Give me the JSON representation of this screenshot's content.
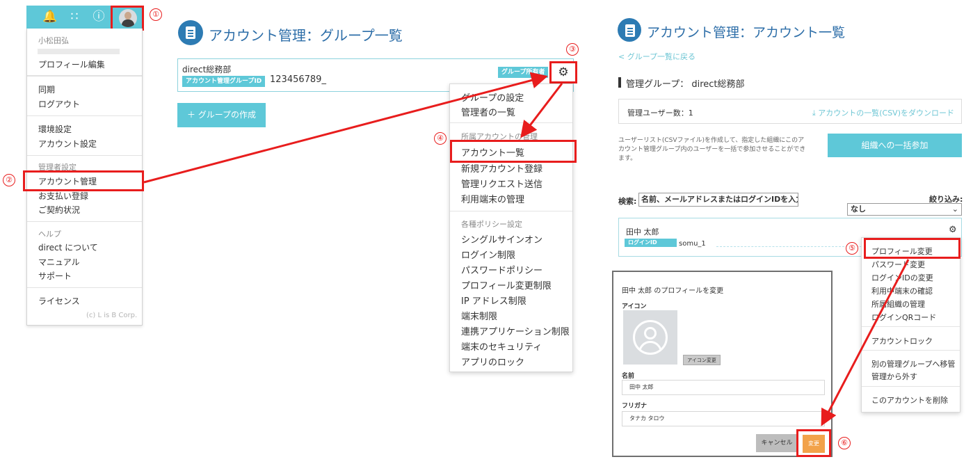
{
  "user_menu": {
    "header_icons": [
      "bell-icon",
      "apps-grid-icon",
      "info-icon"
    ],
    "user_name": "小松田弘",
    "items": [
      {
        "label": "プロフィール編集"
      },
      {
        "label": "同期"
      },
      {
        "label": "ログアウト"
      },
      {
        "label": "環境設定"
      },
      {
        "label": "アカウント設定"
      },
      {
        "label": "管理者設定",
        "type": "section"
      },
      {
        "label": "アカウント管理"
      },
      {
        "label": "お支払い登録"
      },
      {
        "label": "ご契約状況"
      },
      {
        "label": "ヘルプ",
        "type": "section"
      },
      {
        "label": "direct について"
      },
      {
        "label": "マニュアル"
      },
      {
        "label": "サポート"
      },
      {
        "label": "ライセンス"
      }
    ],
    "copyright": "(c) L is B Corp."
  },
  "steps": [
    "①",
    "②",
    "③",
    "④",
    "⑤",
    "⑥"
  ],
  "group_page": {
    "title": "アカウント管理：グループ一覧",
    "group_name": "direct総務部",
    "group_id_tag": "アカウント管理グループID",
    "group_id": "123456789_",
    "owner_tag": "グループ所有者",
    "create_button": "＋ グループの作成"
  },
  "settings_menu": {
    "items": [
      {
        "label": "グループの設定"
      },
      {
        "label": "管理者の一覧"
      },
      {
        "label": "所属アカウントの管理",
        "type": "section"
      },
      {
        "label": "アカウント一覧"
      },
      {
        "label": "新規アカウント登録"
      },
      {
        "label": "管理リクエスト送信"
      },
      {
        "label": "利用端末の管理"
      },
      {
        "label": "各種ポリシー設定",
        "type": "section"
      },
      {
        "label": "シングルサインオン"
      },
      {
        "label": "ログイン制限"
      },
      {
        "label": "パスワードポリシー"
      },
      {
        "label": "プロフィール変更制限"
      },
      {
        "label": "IP アドレス制限"
      },
      {
        "label": "端末制限"
      },
      {
        "label": "連携アプリケーション制限"
      },
      {
        "label": "端末のセキュリティ"
      },
      {
        "label": "アプリのロック"
      }
    ]
  },
  "account_page": {
    "title": "アカウント管理：アカウント一覧",
    "back_link": "< グループ一覧に戻る",
    "managed_group": "管理グループ： direct総務部",
    "admin_count": "管理ユーザー数：1",
    "csv_link": "アカウントの一覧(CSV)をダウンロード",
    "csv_description": "ユーザーリスト(CSVファイル)を作成して、指定した組織にこのアカウント管理グループ内のユーザーを一括で参加させることができます。",
    "bulk_join_button": "組織への一括参加",
    "search_label": "検索:",
    "search_placeholder": "名前、メールアドレスまたはログインIDを入力",
    "filter_label": "絞り込み:",
    "filter_value": "なし",
    "user": {
      "name": "田中 太郎",
      "login_tag": "ログインID",
      "login_id": "somu_1"
    }
  },
  "user_action_menu": {
    "items": [
      {
        "label": "プロフィール変更"
      },
      {
        "label": "パスワード変更"
      },
      {
        "label": "ログインIDの変更"
      },
      {
        "label": "利用中端末の確認"
      },
      {
        "label": "所属組織の管理"
      },
      {
        "label": "ログインQRコード"
      },
      {
        "label": "アカウントロック"
      },
      {
        "label": "別の管理グループへ移管"
      },
      {
        "label": "管理から外す"
      },
      {
        "label": "このアカウントを削除"
      }
    ]
  },
  "profile_dialog": {
    "title": "田中 太郎 のプロフィールを変更",
    "icon_label": "アイコン",
    "icon_change_button": "アイコン変更",
    "name_label": "名前",
    "name_value": "田中 太郎",
    "kana_label": "フリガナ",
    "kana_value": "タナカ タロウ",
    "cancel_button": "キャンセル",
    "submit_button": "変更"
  },
  "colors": {
    "accent": "#5ec8d8",
    "title_blue": "#2d6ea8",
    "highlight_red": "#e81d1d",
    "submit_orange": "#f2a24a"
  }
}
